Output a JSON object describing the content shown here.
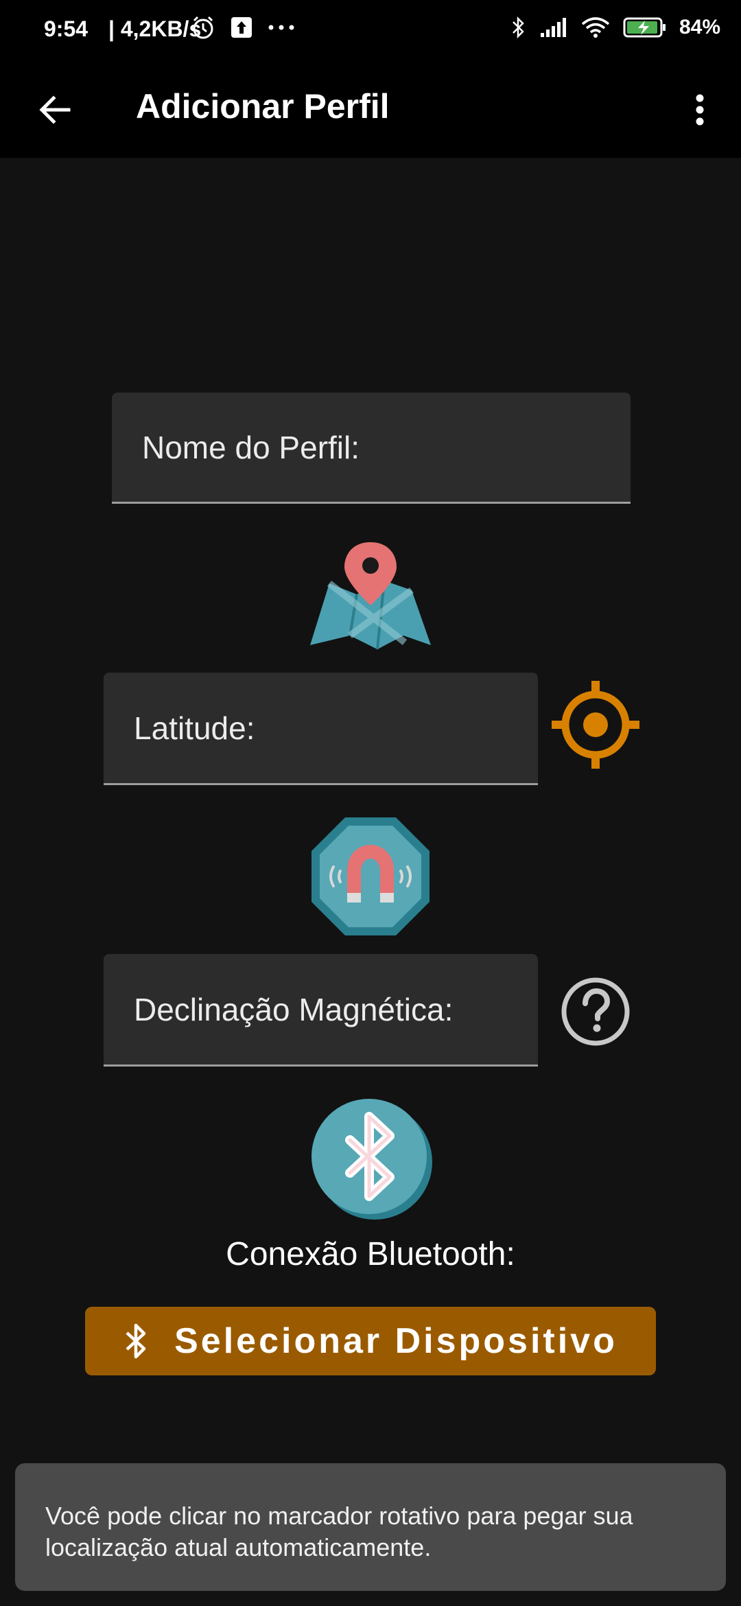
{
  "status_bar": {
    "time": "9:54",
    "speed": "| 4,2KB/s",
    "battery": "84%"
  },
  "app_bar": {
    "title": "Adicionar Perfil"
  },
  "form": {
    "profile_name_placeholder": "Nome do Perfil:",
    "latitude_placeholder": "Latitude:",
    "declination_placeholder": "Declinação Magnética:"
  },
  "bluetooth": {
    "label": "Conexão Bluetooth:",
    "select_button": "Selecionar Dispositivo"
  },
  "toast": {
    "message": "Você pode clicar no marcador rotativo para pegar sua localização atual automaticamente."
  },
  "colors": {
    "accent": "#d88100",
    "button_bg": "#9a5b00",
    "icon_teal": "#4aa0b0",
    "icon_pink": "#e57373"
  },
  "icons": {
    "back": "arrow-left-icon",
    "menu": "more-vertical-icon",
    "map": "map-pin-icon",
    "gps": "crosshair-icon",
    "magnet": "magnet-icon",
    "help": "help-circle-icon",
    "bluetooth": "bluetooth-icon"
  }
}
